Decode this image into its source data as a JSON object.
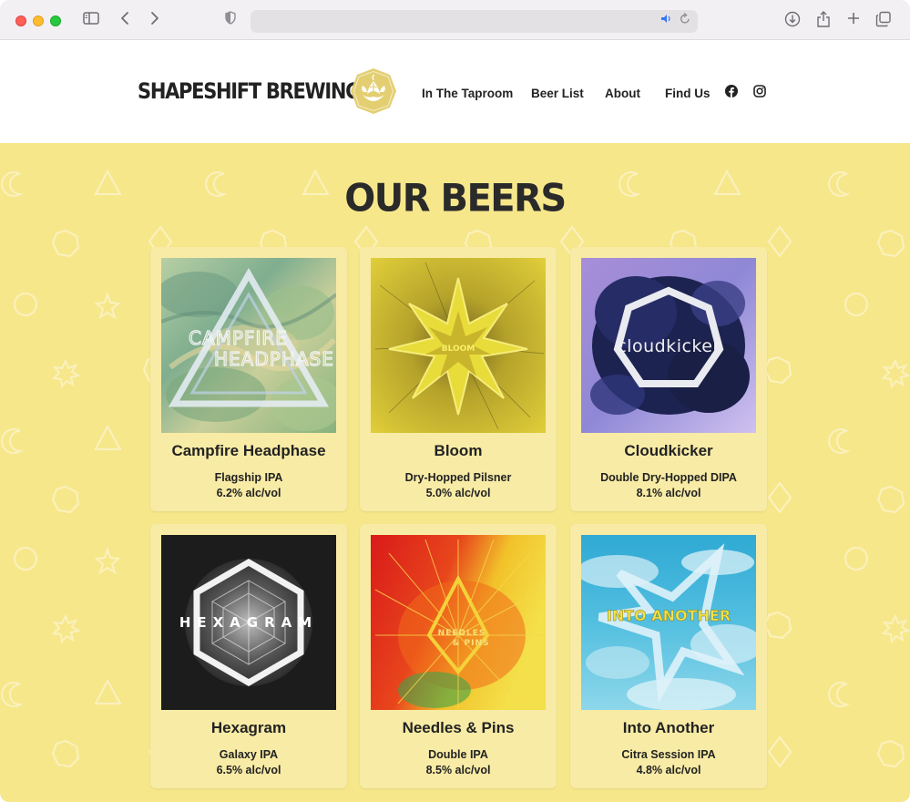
{
  "browser": {
    "sidebar_icon": "sidebar-icon",
    "back_icon": "‹",
    "forward_icon": "›",
    "url": ""
  },
  "header": {
    "brand": "SHAPESHIFT BREWING",
    "nav": [
      "In The Taproom",
      "Beer List",
      "About",
      "Find Us"
    ]
  },
  "main": {
    "title": "OUR BEERS",
    "beers": [
      {
        "name": "Campfire Headphase",
        "style": "Flagship IPA",
        "abv": "6.2% alc/vol",
        "art_text": "CAMPFIRE HEADPHASE"
      },
      {
        "name": "Bloom",
        "style": "Dry-Hopped Pilsner",
        "abv": "5.0% alc/vol",
        "art_text": "BLOOM"
      },
      {
        "name": "Cloudkicker",
        "style": "Double Dry-Hopped DIPA",
        "abv": "8.1% alc/vol",
        "art_text": "cloudkicker"
      },
      {
        "name": "Hexagram",
        "style": "Galaxy IPA",
        "abv": "6.5% alc/vol",
        "art_text": "HEXAGRAM"
      },
      {
        "name": "Needles & Pins",
        "style": "Double IPA",
        "abv": "8.5% alc/vol",
        "art_text_1": "NEEDLES",
        "art_text_2": "& PINS"
      },
      {
        "name": "Into Another",
        "style": "Citra Session IPA",
        "abv": "4.8% alc/vol",
        "art_text": "INTO ANOTHER"
      }
    ]
  },
  "colors": {
    "background_yellow": "#f7e78b",
    "card": "#f8eba5",
    "logo_gold": "#e3cf72",
    "text": "#222222"
  }
}
